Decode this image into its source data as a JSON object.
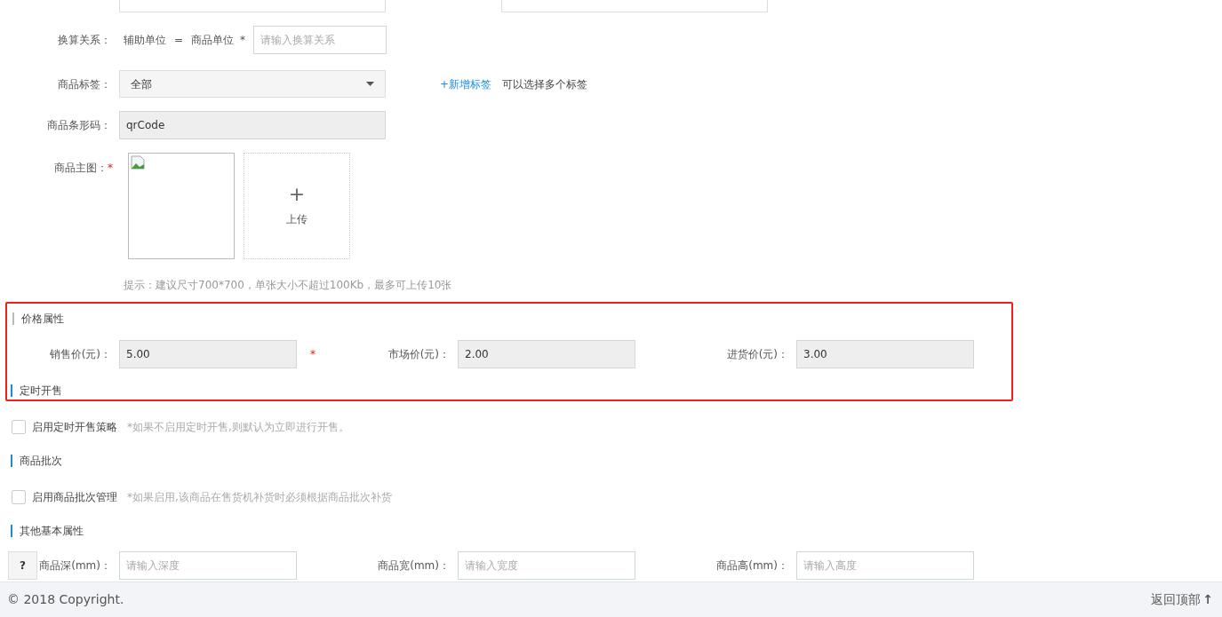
{
  "form": {
    "conversion": {
      "label": "换算关系：",
      "left": "辅助单位",
      "equals": "=",
      "right": "商品单位",
      "required_mark": "*",
      "placeholder": "请输入换算关系"
    },
    "tags": {
      "label": "商品标签：",
      "value": "全部",
      "add_link": "+新增标签",
      "hint": "可以选择多个标签"
    },
    "barcode": {
      "label": "商品条形码：",
      "value": "qrCode"
    },
    "main_image": {
      "label": "商品主图：",
      "required_mark": "*",
      "upload_symbol": "+",
      "upload_label": "上传",
      "hint": "提示：建议尺寸700*700，单张大小不超过100Kb，最多可上传10张"
    }
  },
  "price_section": {
    "title": "价格属性",
    "fields": [
      {
        "label": "销售价(元)：",
        "value": "5.00",
        "required_mark": "*"
      },
      {
        "label": "市场价(元)：",
        "value": "2.00"
      },
      {
        "label": "进货价(元)：",
        "value": "3.00"
      }
    ]
  },
  "sections": [
    {
      "title": "定时开售",
      "kind": "checkbox",
      "checkbox": {
        "label": "启用定时开售策略",
        "checked": false,
        "note": "*如果不启用定时开售,则默认为立即进行开售。"
      }
    },
    {
      "title": "商品批次",
      "kind": "checkbox",
      "checkbox": {
        "label": "启用商品批次管理",
        "checked": false,
        "note": "*如果启用,该商品在售货机补货时必须根据商品批次补货"
      }
    },
    {
      "title": "其他基本属性",
      "kind": "inputs",
      "fields": [
        {
          "label": "商品深(mm)：",
          "placeholder": "请输入深度"
        },
        {
          "label": "商品宽(mm)：",
          "placeholder": "请输入宽度"
        },
        {
          "label": "商品高(mm)：",
          "placeholder": "请输入高度"
        }
      ]
    }
  ],
  "help_button": "?",
  "footer": {
    "copyright": "© 2018 Copyright.",
    "back_to_top": "返回顶部",
    "back_to_top_arrow": "↑"
  }
}
